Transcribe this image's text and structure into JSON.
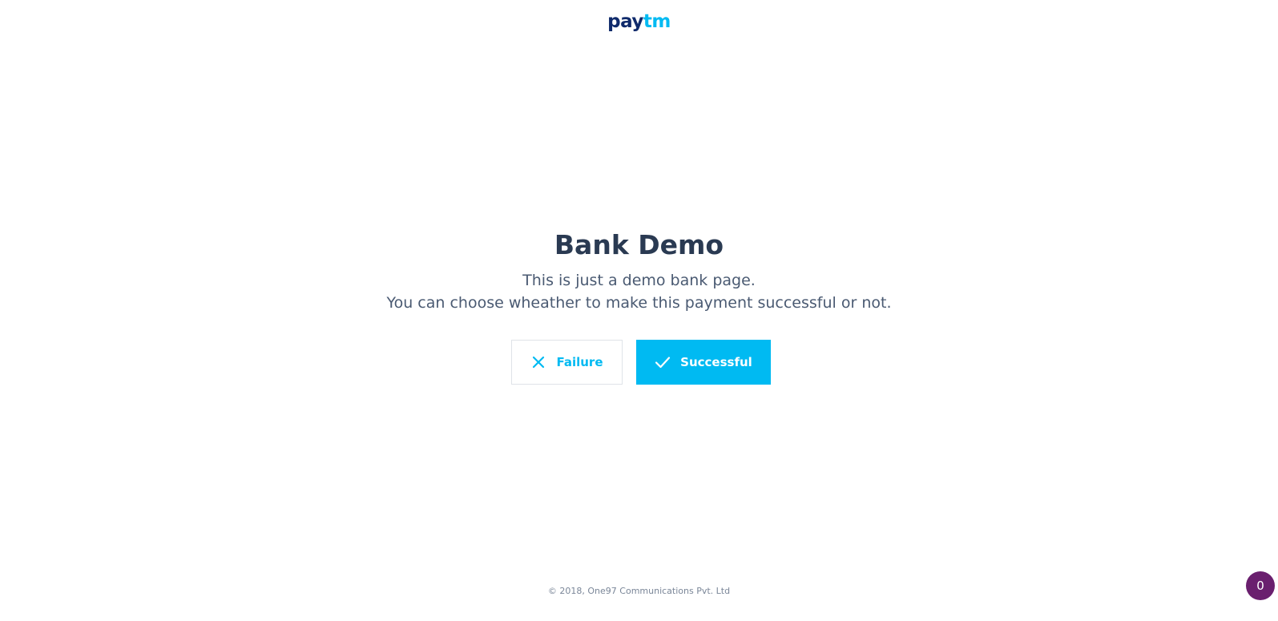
{
  "header": {
    "logo_pay": "pay",
    "logo_tm": "tm"
  },
  "main": {
    "title": "Bank Demo",
    "description_line1": "This is just a demo bank page.",
    "description_line2": "You can choose wheather to make this payment successful or not."
  },
  "buttons": {
    "failure_label": "Failure",
    "failure_icon": "close-icon",
    "success_label": "Successful",
    "success_icon": "check-icon"
  },
  "footer": {
    "copyright": "© 2018, One97 Communications Pvt. Ltd"
  },
  "badge": {
    "count": "0"
  },
  "colors": {
    "brand_dark": "#0f2a6b",
    "brand_accent": "#00baf2",
    "badge_bg": "#6a1f6e"
  }
}
